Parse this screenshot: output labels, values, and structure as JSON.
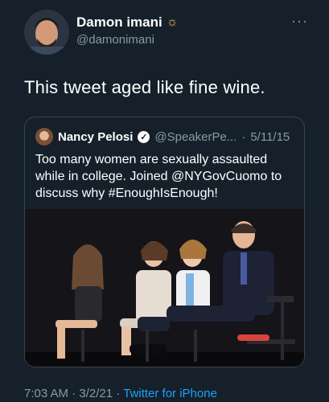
{
  "author": {
    "display_name": "Damon imani",
    "handle": "@damonimani",
    "badge_icon": "sun-icon"
  },
  "tweet": {
    "text": "This tweet aged like fine wine."
  },
  "quoted_tweet": {
    "name": "Nancy Pelosi",
    "handle": "@SpeakerPe...",
    "separator": "·",
    "date": "5/11/15",
    "text": "Too many women are sexually assaulted while in college. Joined @NYGovCuomo to discuss why #EnoughIsEnough!"
  },
  "footer": {
    "time": "7:03 AM",
    "separator": "·",
    "date": "3/2/21",
    "separator2": "·",
    "source": "Twitter for iPhone"
  },
  "colors": {
    "background": "#15202b",
    "secondary_text": "#8899a6",
    "link": "#1da1f2",
    "border": "#38444d"
  }
}
